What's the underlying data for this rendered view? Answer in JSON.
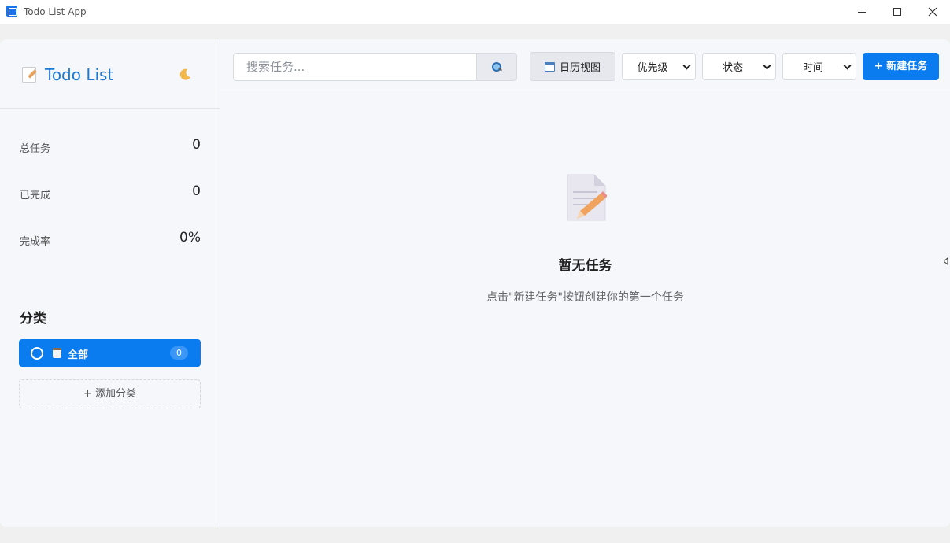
{
  "window": {
    "title": "Todo List App"
  },
  "sidebar": {
    "brand": "Todo List",
    "stats": [
      {
        "label": "总任务",
        "value": "0"
      },
      {
        "label": "已完成",
        "value": "0"
      },
      {
        "label": "完成率",
        "value": "0%"
      }
    ],
    "categories_title": "分类",
    "categories": [
      {
        "label": "全部",
        "count": "0",
        "selected": true
      }
    ],
    "add_category_label": "+ 添加分类"
  },
  "toolbar": {
    "search_placeholder": "搜索任务...",
    "calendar_label": "日历视图",
    "priority_select": "优先级",
    "status_select": "状态",
    "time_select": "时间",
    "new_task_label": "+ 新建任务"
  },
  "empty_state": {
    "title": "暂无任务",
    "description": "点击\"新建任务\"按钮创建你的第一个任务"
  },
  "colors": {
    "accent": "#0b7cf0",
    "brand_text": "#1a7ad6",
    "background": "#f6f7fb"
  }
}
